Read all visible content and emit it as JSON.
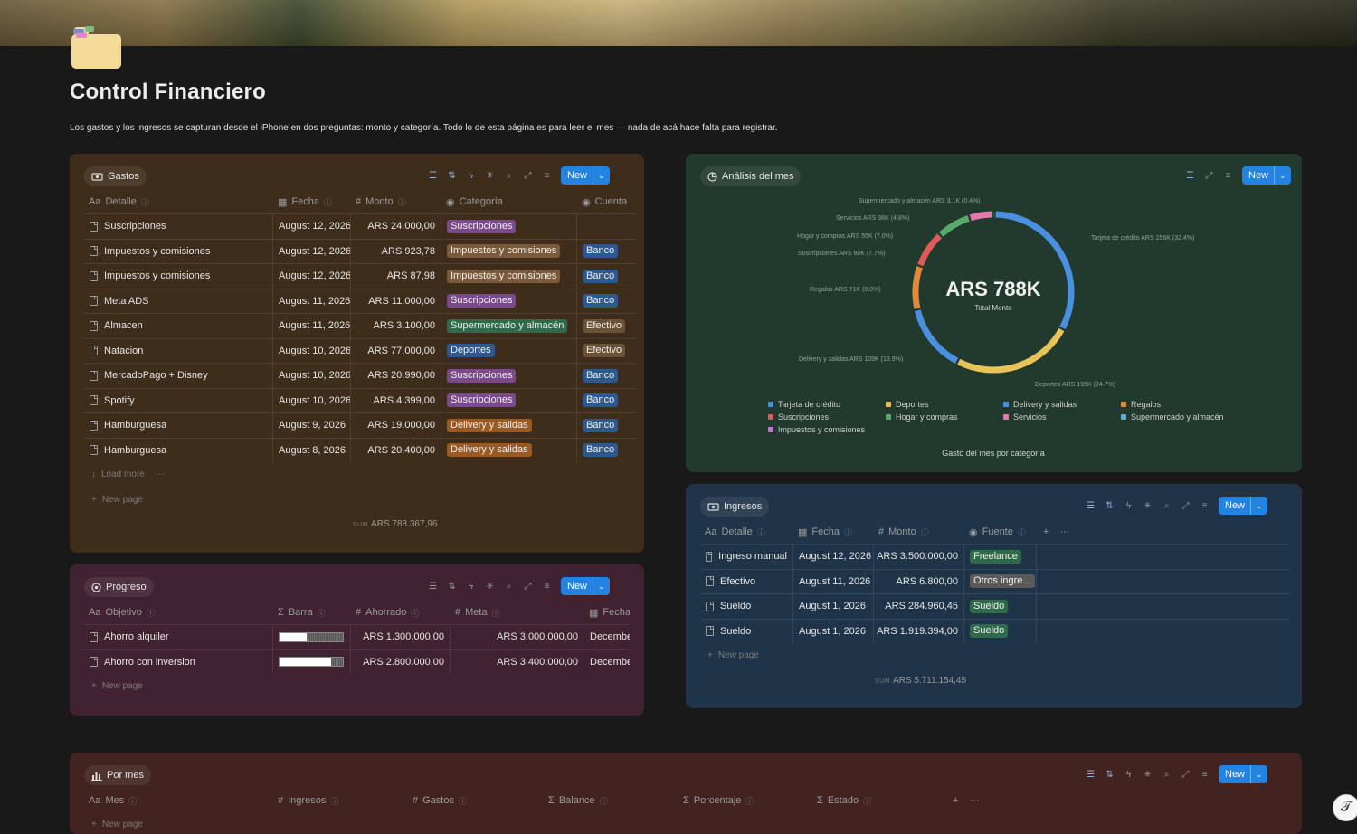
{
  "page": {
    "title": "Control Financiero",
    "description": "Los gastos y los ingresos se capturan desde el iPhone en dos preguntas: monto y categoría. Todo lo de esta página es para leer el mes — nada de acá hace falta para registrar."
  },
  "colors": {
    "blue": "#2383e2",
    "tag_purple": "#7a4a8a",
    "tag_brown": "#7a5a3a",
    "tag_green": "#2f6b4a",
    "tag_blue": "#2d5a8c",
    "tag_orange": "#9a5a22",
    "tag_gray": "#5a5a5a"
  },
  "gastos": {
    "title": "Gastos",
    "new_label": "New",
    "cols": [
      "Detalle",
      "Fecha",
      "Monto",
      "Categoría",
      "Cuenta"
    ],
    "rows": [
      {
        "detalle": "Suscripciones",
        "fecha": "August 12, 2026",
        "monto": "ARS 24.000,00",
        "categoria": "Suscripciones",
        "cuenta": ""
      },
      {
        "detalle": "Impuestos y comisiones",
        "fecha": "August 12, 2026",
        "monto": "ARS 923,78",
        "categoria": "Impuestos y comisiones",
        "cuenta": "Banco"
      },
      {
        "detalle": "Impuestos y comisiones",
        "fecha": "August 12, 2026",
        "monto": "ARS 87,98",
        "categoria": "Impuestos y comisiones",
        "cuenta": "Banco"
      },
      {
        "detalle": "Meta ADS",
        "fecha": "August 11, 2026",
        "monto": "ARS 11.000,00",
        "categoria": "Suscripciones",
        "cuenta": "Banco"
      },
      {
        "detalle": "Almacen",
        "fecha": "August 11, 2026",
        "monto": "ARS 3.100,00",
        "categoria": "Supermercado y almacén",
        "cuenta": "Efectivo"
      },
      {
        "detalle": "Natacion",
        "fecha": "August 10, 2026",
        "monto": "ARS 77.000,00",
        "categoria": "Deportes",
        "cuenta": "Efectivo"
      },
      {
        "detalle": "MercadoPago + Disney",
        "fecha": "August 10, 2026",
        "monto": "ARS 20.990,00",
        "categoria": "Suscripciones",
        "cuenta": "Banco"
      },
      {
        "detalle": "Spotify",
        "fecha": "August 10, 2026",
        "monto": "ARS 4.399,00",
        "categoria": "Suscripciones",
        "cuenta": "Banco"
      },
      {
        "detalle": "Hamburguesa",
        "fecha": "August 9, 2026",
        "monto": "ARS 19.000,00",
        "categoria": "Delivery y salidas",
        "cuenta": "Banco"
      },
      {
        "detalle": "Hamburguesa",
        "fecha": "August 8, 2026",
        "monto": "ARS 20.400,00",
        "categoria": "Delivery y salidas",
        "cuenta": "Banco"
      }
    ],
    "load_more": "Load more",
    "new_page": "New page",
    "sum_label": "SUM",
    "sum_value": "ARS 788.367,96"
  },
  "progreso": {
    "title": "Progreso",
    "new_label": "New",
    "cols": [
      "Objetivo",
      "Barra",
      "Ahorrado",
      "Meta",
      "Fecha"
    ],
    "rows": [
      {
        "objetivo": "Ahorro alquiler",
        "progress": 0.43,
        "ahorrado": "ARS 1.300.000,00",
        "meta": "ARS 3.000.000,00",
        "fecha": "December"
      },
      {
        "objetivo": "Ahorro con inversion",
        "progress": 0.82,
        "ahorrado": "ARS 2.800.000,00",
        "meta": "ARS 3.400.000,00",
        "fecha": "December"
      }
    ],
    "new_page": "New page"
  },
  "analisis": {
    "title": "Análisis del mes",
    "new_label": "New",
    "center_value": "ARS 788K",
    "center_label": "Total Monto",
    "caption": "Gasto del mes por categoría",
    "slice_labels": {
      "tarjeta": "Tarjeta de crédito  ARS 256K (32.4%)",
      "deportes": "Deportes  ARS 195K (24.7%)",
      "delivery": "Delivery y salidas  ARS 109K (13.9%)",
      "regalos": "Regalos  ARS 71K (9.0%)",
      "suscripciones": "Suscripciones  ARS 60K (7.7%)",
      "hogar": "Hogar y compras  ARS 55K (7.0%)",
      "servicios": "Servicios  ARS 38K (4.8%)",
      "super": "Supermercado y almacén  ARS 3.1K (0.4%)"
    },
    "legend": [
      "Tarjeta de crédito",
      "Deportes",
      "Delivery y salidas",
      "Regalos",
      "Suscripciones",
      "Hogar y compras",
      "Servicios",
      "Supermercado y almacén",
      "Impuestos y comisiones"
    ]
  },
  "chart_data": {
    "type": "pie",
    "categories": [
      "Tarjeta de crédito",
      "Deportes",
      "Delivery y salidas",
      "Regalos",
      "Suscripciones",
      "Hogar y compras",
      "Servicios",
      "Supermercado y almacén"
    ],
    "values": [
      256,
      195,
      109,
      71,
      60,
      55,
      38,
      3.1
    ],
    "percent": [
      32.4,
      24.7,
      13.9,
      9.0,
      7.7,
      7.0,
      4.8,
      0.4
    ],
    "colors": [
      "#4a8fe0",
      "#e8c35a",
      "#4a8fe0",
      "#e08a3a",
      "#e05a5a",
      "#5aaa6a",
      "#e07aaa",
      "#5ab0d0"
    ],
    "title": "Gasto del mes por categoría",
    "center": "ARS 788K"
  },
  "ingresos": {
    "title": "Ingresos",
    "new_label": "New",
    "cols": [
      "Detalle",
      "Fecha",
      "Monto",
      "Fuente"
    ],
    "rows": [
      {
        "detalle": "Ingreso manual",
        "fecha": "August 12, 2026",
        "monto": "ARS 3.500.000,00",
        "fuente": "Freelance"
      },
      {
        "detalle": "Efectivo",
        "fecha": "August 11, 2026",
        "monto": "ARS 6.800,00",
        "fuente": "Otros ingre..."
      },
      {
        "detalle": "Sueldo",
        "fecha": "August 1, 2026",
        "monto": "ARS 284.960,45",
        "fuente": "Sueldo"
      },
      {
        "detalle": "Sueldo",
        "fecha": "August 1, 2026",
        "monto": "ARS 1.919.394,00",
        "fuente": "Sueldo"
      }
    ],
    "new_page": "New page",
    "sum_label": "SUM",
    "sum_value": "ARS 5.711.154,45"
  },
  "por_mes": {
    "title": "Por mes",
    "new_label": "New",
    "cols": [
      "Mes",
      "Ingresos",
      "Gastos",
      "Balance",
      "Porcentaje",
      "Estado"
    ],
    "new_page": "New page"
  }
}
